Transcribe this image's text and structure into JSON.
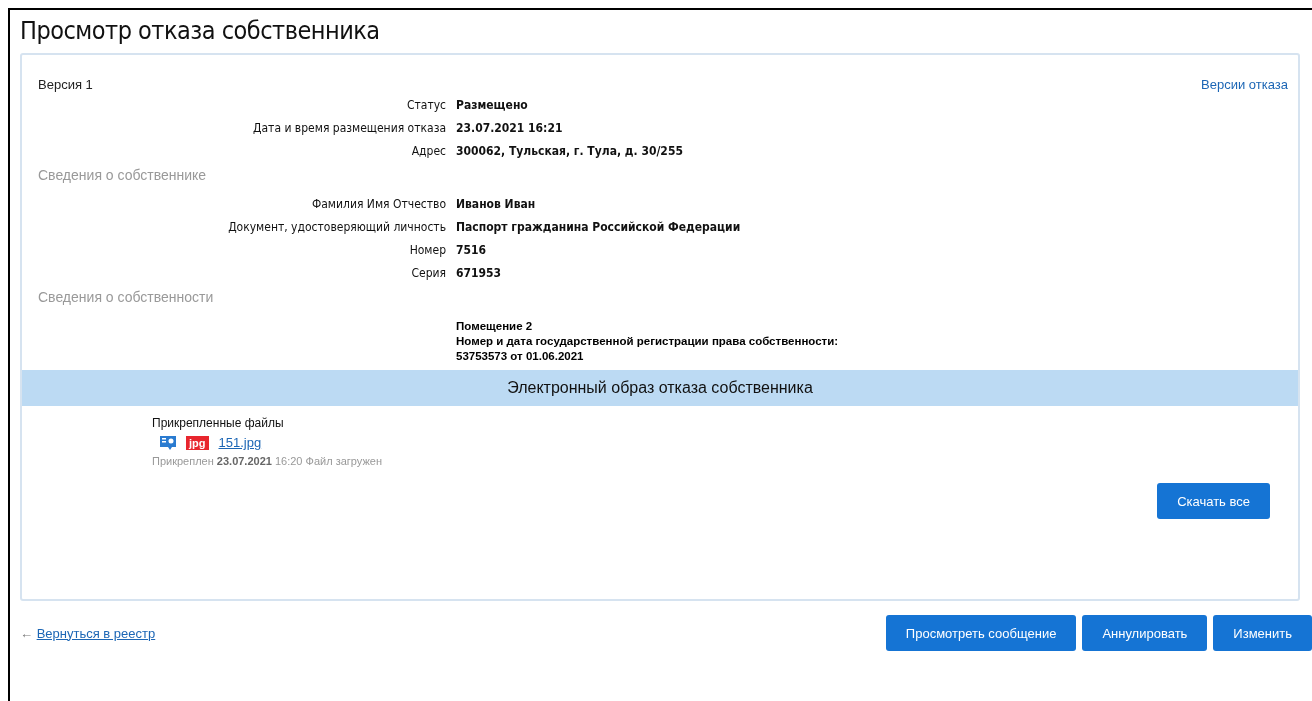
{
  "title": "Просмотр отказа собственника",
  "version": "Версия 1",
  "versions_link": "Версии отказа",
  "rows": [
    {
      "kind": "field",
      "label": "Статус",
      "value": "Размещено"
    },
    {
      "kind": "field",
      "label": "Дата и время размещения отказа",
      "value": "23.07.2021 16:21"
    },
    {
      "kind": "field",
      "label": "Адрес",
      "value": "300062, Тульская, г. Тула, д. 30/255"
    },
    {
      "kind": "section",
      "label": "Сведения о собственнике"
    },
    {
      "kind": "field",
      "label": "Фамилия Имя Отчество",
      "value": "Иванов Иван"
    },
    {
      "kind": "field",
      "label": "Документ, удостоверяющий личность",
      "value": "Паспорт гражданина Российской Федерации"
    },
    {
      "kind": "field",
      "label": "Номер",
      "value": "7516"
    },
    {
      "kind": "field",
      "label": "Серия",
      "value": "671953"
    },
    {
      "kind": "section",
      "label": "Сведения о собственности"
    },
    {
      "kind": "block",
      "lines": [
        "Помещение 2",
        "Номер и дата государственной регистрации права собственности:",
        "53753573 от 01.06.2021"
      ]
    }
  ],
  "attachments": {
    "header": "Электронный образ отказа собственника",
    "label": "Прикрепленные файлы",
    "files": [
      {
        "type_badge": "jpg",
        "name": "151.jpg",
        "meta": "Прикреплен **23.07.2021** 16:20 Файл загружен"
      }
    ],
    "download_all": "Скачать все"
  },
  "back_link": "Вернуться в реестр",
  "back_arrow": "←",
  "buttons": [
    "Просмотреть сообщение",
    "Аннулировать",
    "Изменить"
  ]
}
